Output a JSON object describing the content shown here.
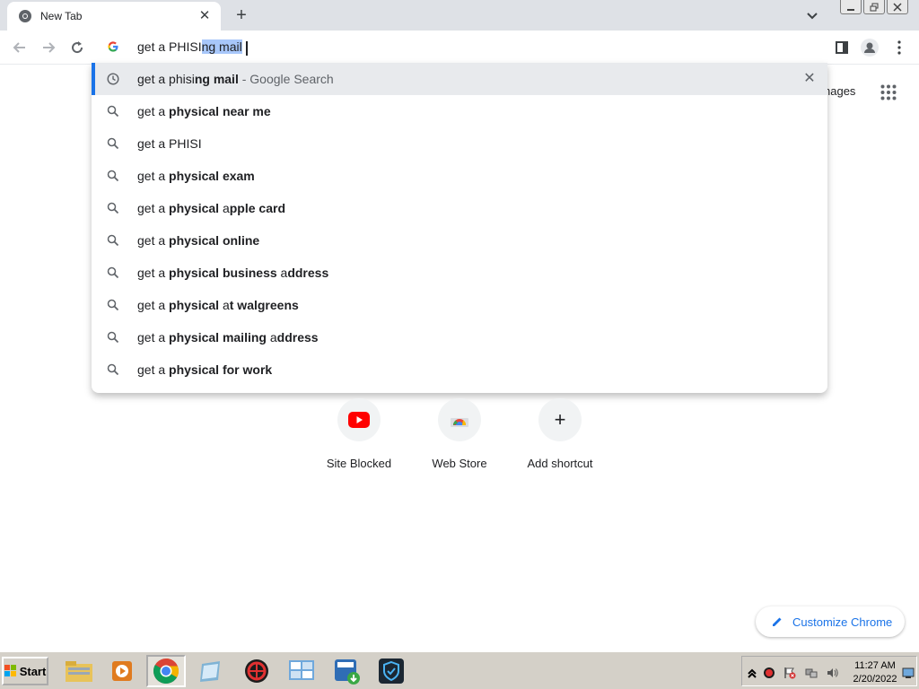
{
  "tab": {
    "title": "New Tab",
    "close": "✕"
  },
  "newtab": "+",
  "omnibox": {
    "typed": "get a PHISI",
    "autocomplete": "ng mail"
  },
  "suggestions": [
    {
      "type": "history",
      "parts": [
        {
          "t": "get a phisi",
          "b": false
        },
        {
          "t": "ng mail",
          "b": true
        },
        {
          "t": " - Google Search",
          "m": true
        }
      ],
      "removable": true
    },
    {
      "type": "search",
      "parts": [
        {
          "t": "get a ",
          "b": false
        },
        {
          "t": "physical near me",
          "b": true
        }
      ]
    },
    {
      "type": "search",
      "parts": [
        {
          "t": "get a PHISI",
          "b": false
        }
      ]
    },
    {
      "type": "search",
      "parts": [
        {
          "t": "get a ",
          "b": false
        },
        {
          "t": "physical exam",
          "b": true
        }
      ]
    },
    {
      "type": "search",
      "parts": [
        {
          "t": "get a ",
          "b": false
        },
        {
          "t": "physical",
          "b": true
        },
        {
          "t": " a",
          "b": false
        },
        {
          "t": "pple card",
          "b": true
        }
      ]
    },
    {
      "type": "search",
      "parts": [
        {
          "t": "get a ",
          "b": false
        },
        {
          "t": "physical online",
          "b": true
        }
      ]
    },
    {
      "type": "search",
      "parts": [
        {
          "t": "get a ",
          "b": false
        },
        {
          "t": "physical business",
          "b": true
        },
        {
          "t": " a",
          "b": false
        },
        {
          "t": "ddress",
          "b": true
        }
      ]
    },
    {
      "type": "search",
      "parts": [
        {
          "t": "get a ",
          "b": false
        },
        {
          "t": "physical",
          "b": true
        },
        {
          "t": " a",
          "b": false
        },
        {
          "t": "t walgreens",
          "b": true
        }
      ]
    },
    {
      "type": "search",
      "parts": [
        {
          "t": "get a ",
          "b": false
        },
        {
          "t": "physical mailing",
          "b": true
        },
        {
          "t": " a",
          "b": false
        },
        {
          "t": "ddress",
          "b": true
        }
      ]
    },
    {
      "type": "search",
      "parts": [
        {
          "t": "get a ",
          "b": false
        },
        {
          "t": "physical for work",
          "b": true
        }
      ]
    }
  ],
  "images_link": "nages",
  "shortcuts": [
    {
      "label": "Site Blocked",
      "icon": "youtube-icon"
    },
    {
      "label": "Web Store",
      "icon": "chrome-web-store-icon"
    },
    {
      "label": "Add shortcut",
      "icon": "plus-icon",
      "glyph": "+"
    }
  ],
  "customize_label": "Customize Chrome",
  "taskbar": {
    "start_label": "Start",
    "clock_time": "11:27 AM",
    "clock_date": "2/20/2022"
  },
  "colors": {
    "accent": "#1a73e8",
    "youtube_red": "#ff0000",
    "selection": "#a8c7fa"
  }
}
